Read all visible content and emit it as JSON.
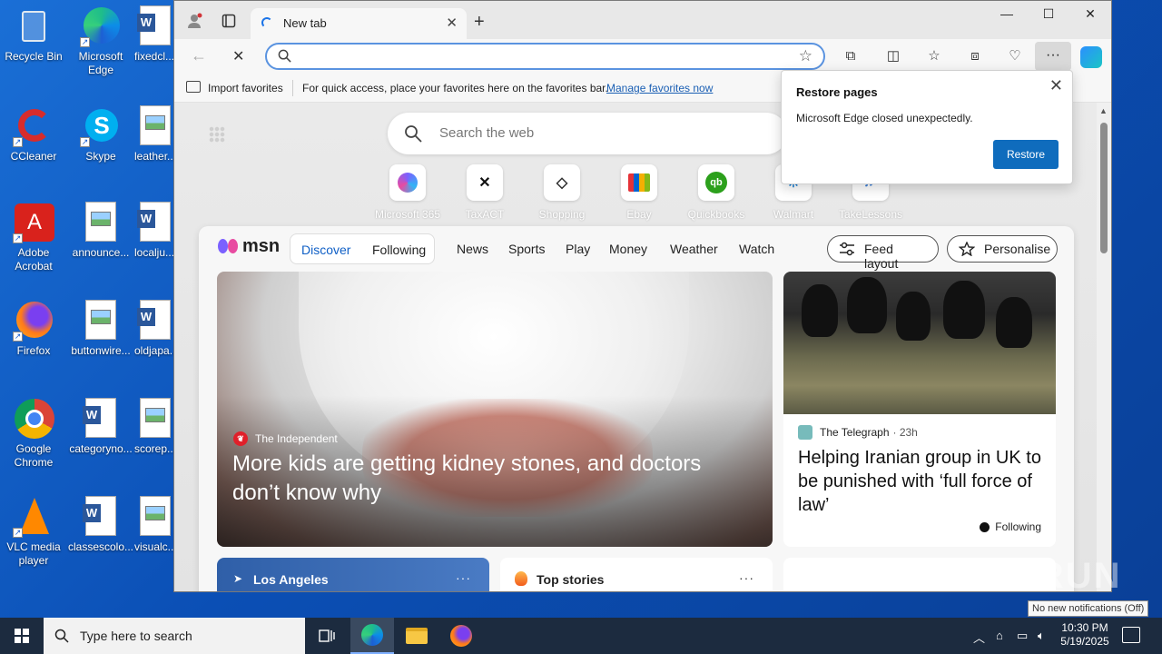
{
  "desktop": {
    "icons": [
      {
        "label": "Recycle Bin"
      },
      {
        "label": "Microsoft Edge"
      },
      {
        "label": "fixedcl..."
      },
      {
        "label": "CCleaner"
      },
      {
        "label": "Skype"
      },
      {
        "label": "leather..."
      },
      {
        "label": "Adobe Acrobat"
      },
      {
        "label": "announce..."
      },
      {
        "label": "localju..."
      },
      {
        "label": "Firefox"
      },
      {
        "label": "buttonwire..."
      },
      {
        "label": "oldjapa..."
      },
      {
        "label": "Google Chrome"
      },
      {
        "label": "categoryno..."
      },
      {
        "label": "scorep..."
      },
      {
        "label": "VLC media player"
      },
      {
        "label": "classescolo..."
      },
      {
        "label": "visualc..."
      }
    ]
  },
  "browser": {
    "tab": {
      "title": "New tab"
    },
    "window_controls": {
      "minimize": "—",
      "maximize": "☐",
      "close": "✕"
    },
    "address": {
      "value": "",
      "placeholder": ""
    },
    "favorites_bar": {
      "import": "Import favorites",
      "quick_access": "For quick access, place your favorites here on the favorites bar.",
      "manage": "Manage favorites now"
    },
    "ntp": {
      "search_placeholder": "Search the web",
      "quick_links": [
        {
          "label": "Microsoft 365",
          "color": "#7b61ff"
        },
        {
          "label": "TaxACT",
          "color": "#111111"
        },
        {
          "label": "Shopping",
          "color": "#333333"
        },
        {
          "label": "Ebay",
          "color": "#e53238"
        },
        {
          "label": "Quickbooks",
          "color": "#2ca01c"
        },
        {
          "label": "Walmart",
          "color": "#0071ce"
        },
        {
          "label": "TakeLessons",
          "color": "#3c7fd8"
        }
      ],
      "feed": {
        "brand": "msn",
        "tabs": {
          "discover": "Discover",
          "following": "Following"
        },
        "nav": [
          "News",
          "Sports",
          "Play",
          "Money",
          "Weather",
          "Watch"
        ],
        "feed_layout": "Feed layout",
        "personalise": "Personalise",
        "hero": {
          "source": "The Independent",
          "headline": "More kids are getting kidney stones, and doctors don’t know why"
        },
        "card2": {
          "source": "The Telegraph",
          "age": "· 23h",
          "headline": "Helping Iranian group in UK to be punished with ‘full force of law’",
          "following": "Following"
        },
        "weather_location": "Los Angeles",
        "top_stories": "Top stories",
        "more": "···"
      }
    },
    "restore_popup": {
      "title": "Restore pages",
      "message": "Microsoft Edge closed unexpectedly.",
      "button": "Restore"
    }
  },
  "taskbar": {
    "search_placeholder": "Type here to search",
    "time": "10:30 PM",
    "date": "5/19/2025",
    "tooltip": "No new notifications (Off)"
  },
  "watermark": "ANY RUN",
  "colors": {
    "accent": "#0f6cbd",
    "taskbar": "#1c2b3f",
    "desktop": "#0b4fb5"
  }
}
